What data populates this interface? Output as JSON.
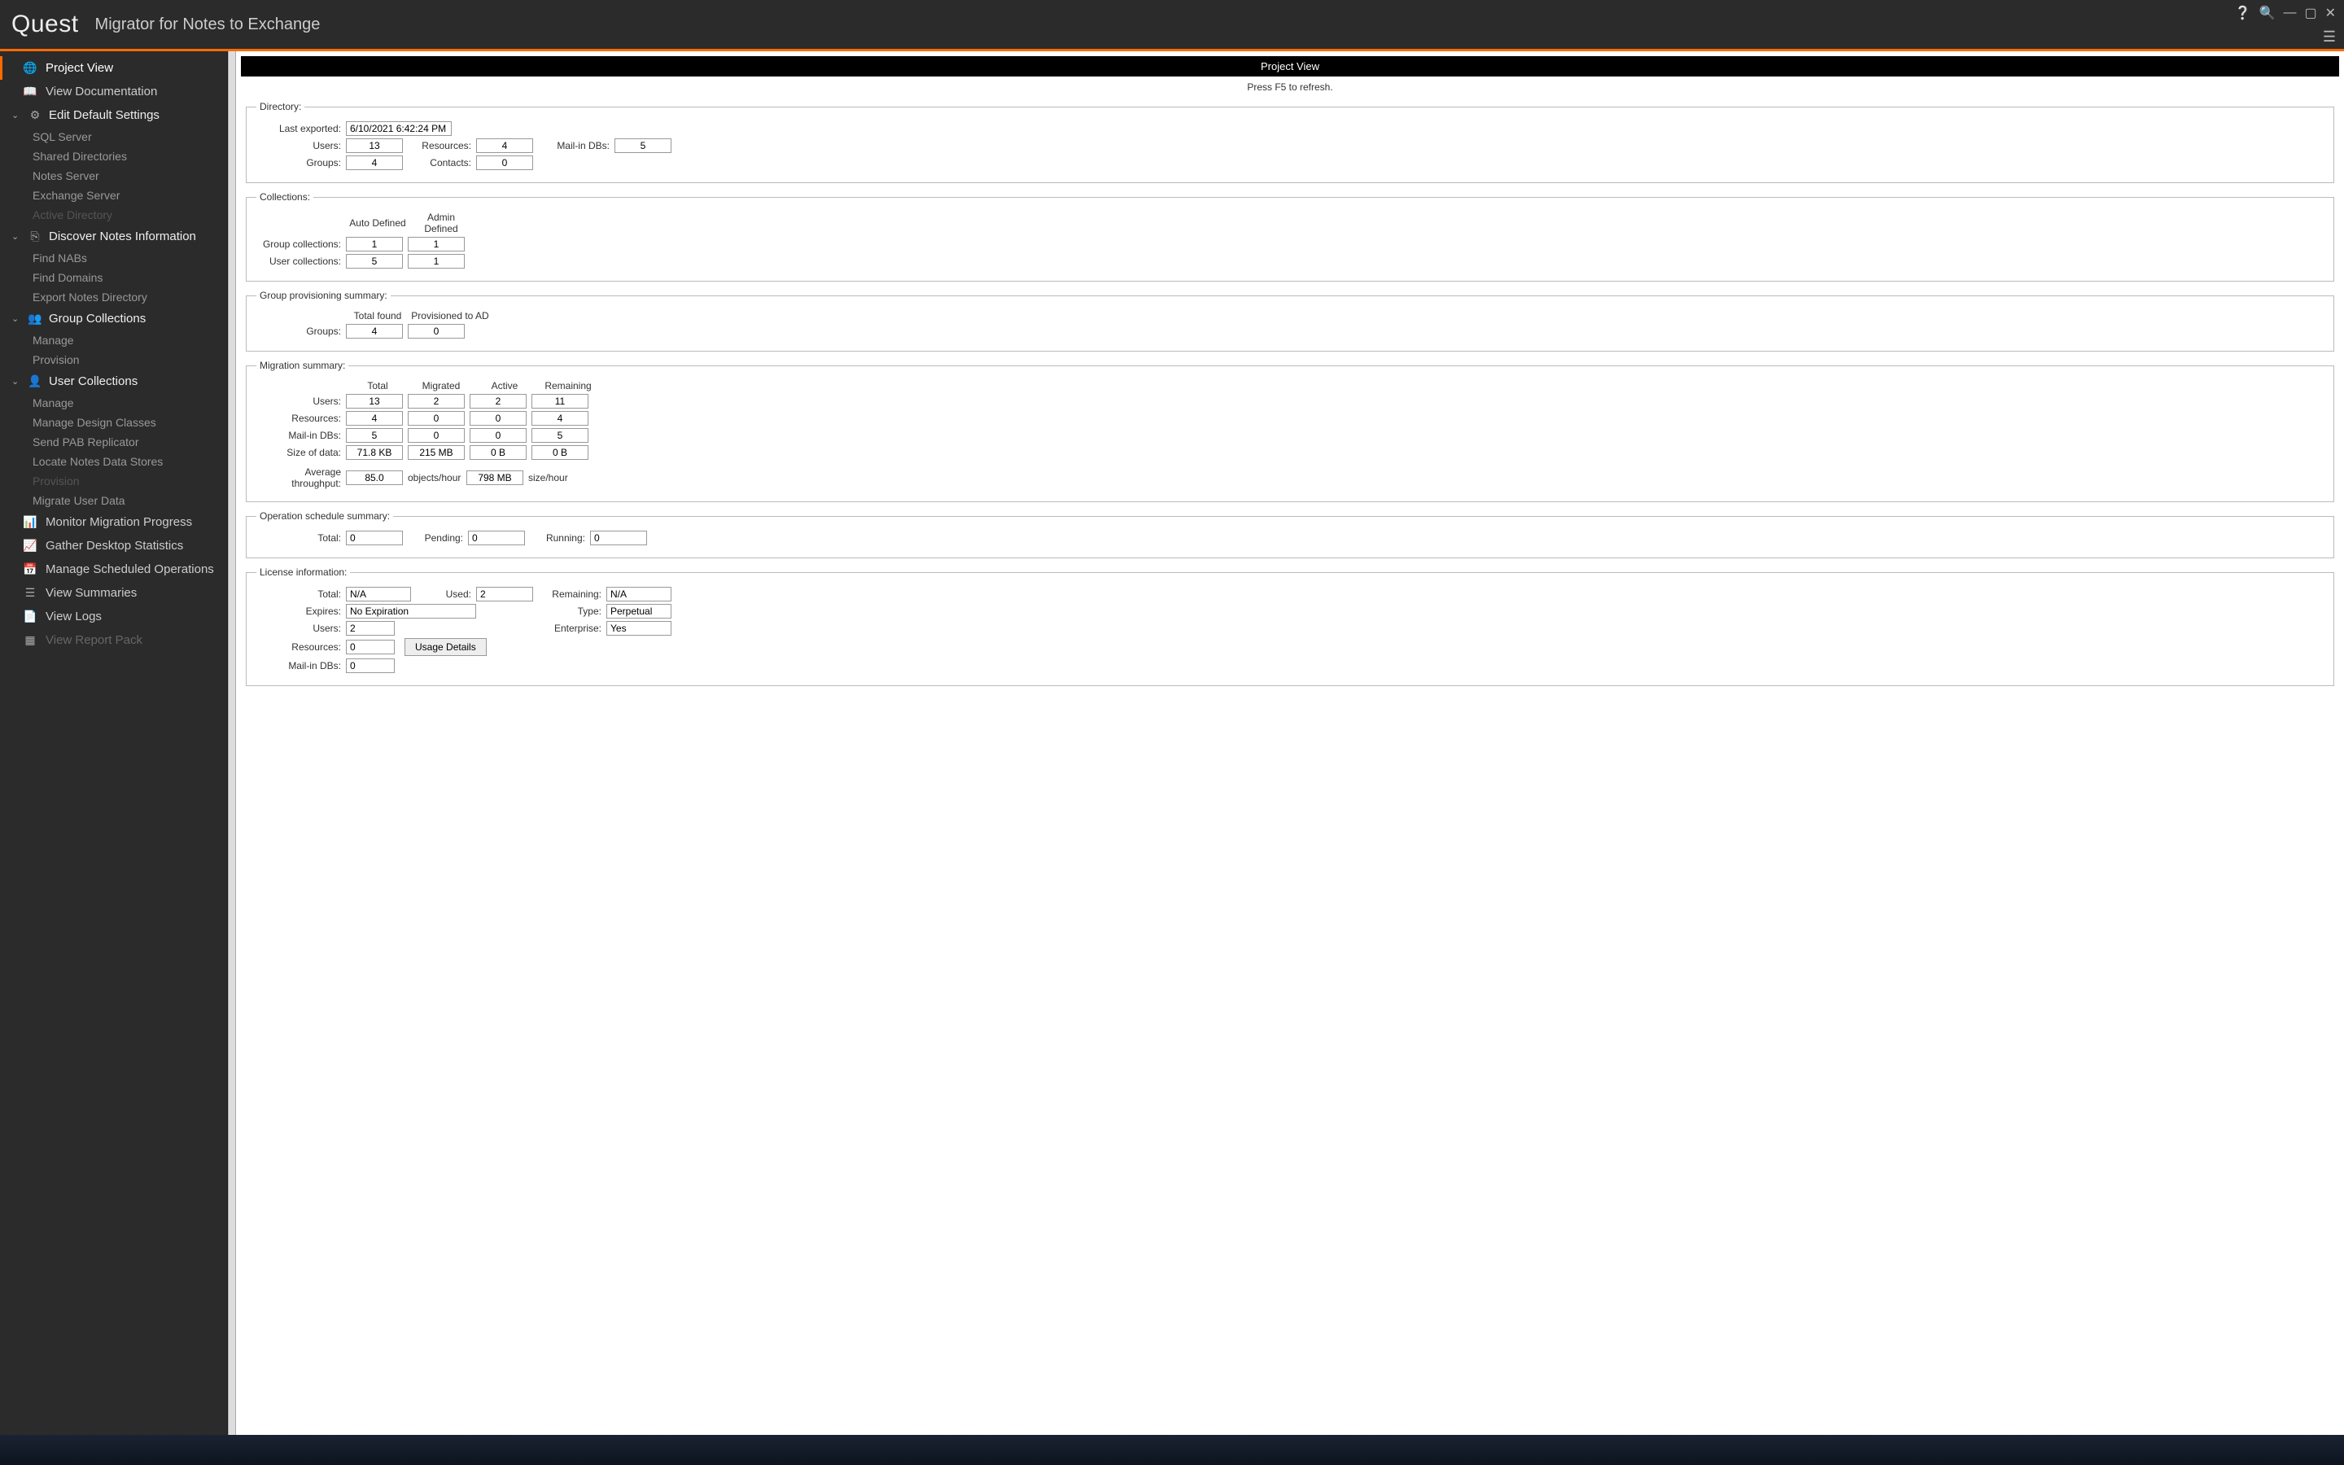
{
  "app": {
    "brand": "Quest",
    "title": "Migrator for Notes to Exchange"
  },
  "sidebar": {
    "project_view": "Project View",
    "view_documentation": "View Documentation",
    "edit_default_settings": {
      "label": "Edit Default Settings",
      "items": [
        "SQL Server",
        "Shared Directories",
        "Notes Server",
        "Exchange Server",
        "Active Directory"
      ]
    },
    "discover_notes": {
      "label": "Discover Notes Information",
      "items": [
        "Find NABs",
        "Find Domains",
        "Export Notes Directory"
      ]
    },
    "group_collections": {
      "label": "Group Collections",
      "items": [
        "Manage",
        "Provision"
      ]
    },
    "user_collections": {
      "label": "User Collections",
      "items": [
        "Manage",
        "Manage Design Classes",
        "Send PAB Replicator",
        "Locate Notes Data Stores",
        "Provision",
        "Migrate User Data"
      ]
    },
    "monitor_migration": "Monitor Migration Progress",
    "gather_desktop": "Gather Desktop Statistics",
    "manage_scheduled": "Manage Scheduled Operations",
    "view_summaries": "View Summaries",
    "view_logs": "View Logs",
    "view_report_pack": "View Report Pack"
  },
  "panel": {
    "title": "Project View",
    "refresh_hint": "Press F5 to refresh."
  },
  "directory": {
    "legend": "Directory:",
    "last_exported_label": "Last exported:",
    "last_exported": "6/10/2021 6:42:24 PM",
    "users_label": "Users:",
    "users": "13",
    "resources_label": "Resources:",
    "resources": "4",
    "mailin_label": "Mail-in DBs:",
    "mailin": "5",
    "groups_label": "Groups:",
    "groups": "4",
    "contacts_label": "Contacts:",
    "contacts": "0"
  },
  "collections": {
    "legend": "Collections:",
    "auto_defined": "Auto Defined",
    "admin_defined": "Admin Defined",
    "group_label": "Group collections:",
    "group_auto": "1",
    "group_admin": "1",
    "user_label": "User collections:",
    "user_auto": "5",
    "user_admin": "1"
  },
  "group_prov": {
    "legend": "Group provisioning summary:",
    "total_found": "Total found",
    "provisioned": "Provisioned to AD",
    "groups_label": "Groups:",
    "groups_total": "4",
    "groups_prov": "0"
  },
  "migration": {
    "legend": "Migration summary:",
    "h_total": "Total",
    "h_migrated": "Migrated",
    "h_active": "Active",
    "h_remaining": "Remaining",
    "users_label": "Users:",
    "users": [
      "13",
      "2",
      "2",
      "11"
    ],
    "resources_label": "Resources:",
    "resources": [
      "4",
      "0",
      "0",
      "4"
    ],
    "mailin_label": "Mail-in DBs:",
    "mailin": [
      "5",
      "0",
      "0",
      "5"
    ],
    "size_label": "Size of data:",
    "size": [
      "71.8 KB",
      "215 MB",
      "0 B",
      "0 B"
    ],
    "throughput_label": "Average throughput:",
    "throughput_obj": "85.0",
    "throughput_obj_unit": "objects/hour",
    "throughput_size": "798 MB",
    "throughput_size_unit": "size/hour"
  },
  "ops": {
    "legend": "Operation schedule summary:",
    "total_label": "Total:",
    "total": "0",
    "pending_label": "Pending:",
    "pending": "0",
    "running_label": "Running:",
    "running": "0"
  },
  "license": {
    "legend": "License information:",
    "total_label": "Total:",
    "total": "N/A",
    "used_label": "Used:",
    "used": "2",
    "remaining_label": "Remaining:",
    "remaining": "N/A",
    "expires_label": "Expires:",
    "expires": "No Expiration",
    "type_label": "Type:",
    "type": "Perpetual",
    "users_label": "Users:",
    "users": "2",
    "enterprise_label": "Enterprise:",
    "enterprise": "Yes",
    "resources_label": "Resources:",
    "resources": "0",
    "mailin_label": "Mail-in DBs:",
    "mailin": "0",
    "usage_btn": "Usage Details"
  }
}
